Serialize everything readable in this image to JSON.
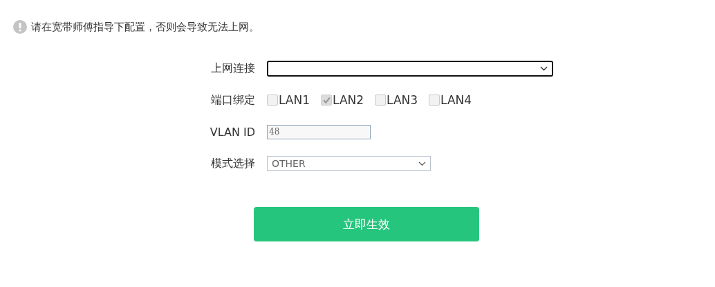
{
  "notice": {
    "text": "请在宽带师傅指导下配置，否则会导致无法上网。"
  },
  "form": {
    "connection": {
      "label": "上网连接",
      "focused": true
    },
    "ports": {
      "label": "端口绑定",
      "items": [
        {
          "label": "LAN1",
          "checked": false
        },
        {
          "label": "LAN2",
          "checked": true
        },
        {
          "label": "LAN3",
          "checked": false
        },
        {
          "label": "LAN4",
          "checked": false
        }
      ]
    },
    "vlan": {
      "label": "VLAN ID",
      "value": "48"
    },
    "mode": {
      "label": "模式选择",
      "value": "OTHER"
    }
  },
  "apply_button": "立即生效"
}
